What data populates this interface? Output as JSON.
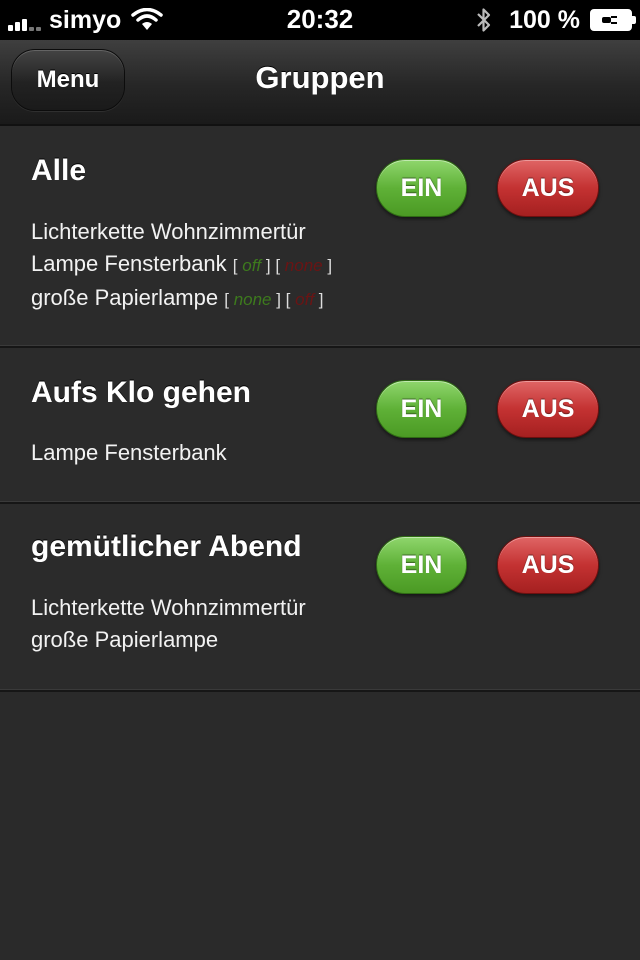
{
  "status_bar": {
    "carrier": "simyo",
    "time": "20:32",
    "battery": "100 %"
  },
  "nav": {
    "menu_label": "Menu",
    "title": "Gruppen"
  },
  "groups": [
    {
      "title": "Alle",
      "on_label": "EIN",
      "off_label": "AUS",
      "devices": [
        {
          "name": "Lichterkette Wohnzimmertür"
        },
        {
          "name": "Lampe Fensterbank",
          "on_state": "off",
          "off_state": "none"
        },
        {
          "name": "große Papierlampe",
          "on_state": "none",
          "off_state": "off"
        }
      ]
    },
    {
      "title": "Aufs Klo gehen",
      "on_label": "EIN",
      "off_label": "AUS",
      "devices": [
        {
          "name": "Lampe Fensterbank"
        }
      ]
    },
    {
      "title": "gemütlicher Abend",
      "on_label": "EIN",
      "off_label": "AUS",
      "devices": [
        {
          "name": "Lichterkette Wohnzimmertür"
        },
        {
          "name": "große Papierlampe"
        }
      ]
    }
  ],
  "colors": {
    "on_green": "#5fb137",
    "off_red": "#c43232",
    "background": "#2a2a2a"
  }
}
